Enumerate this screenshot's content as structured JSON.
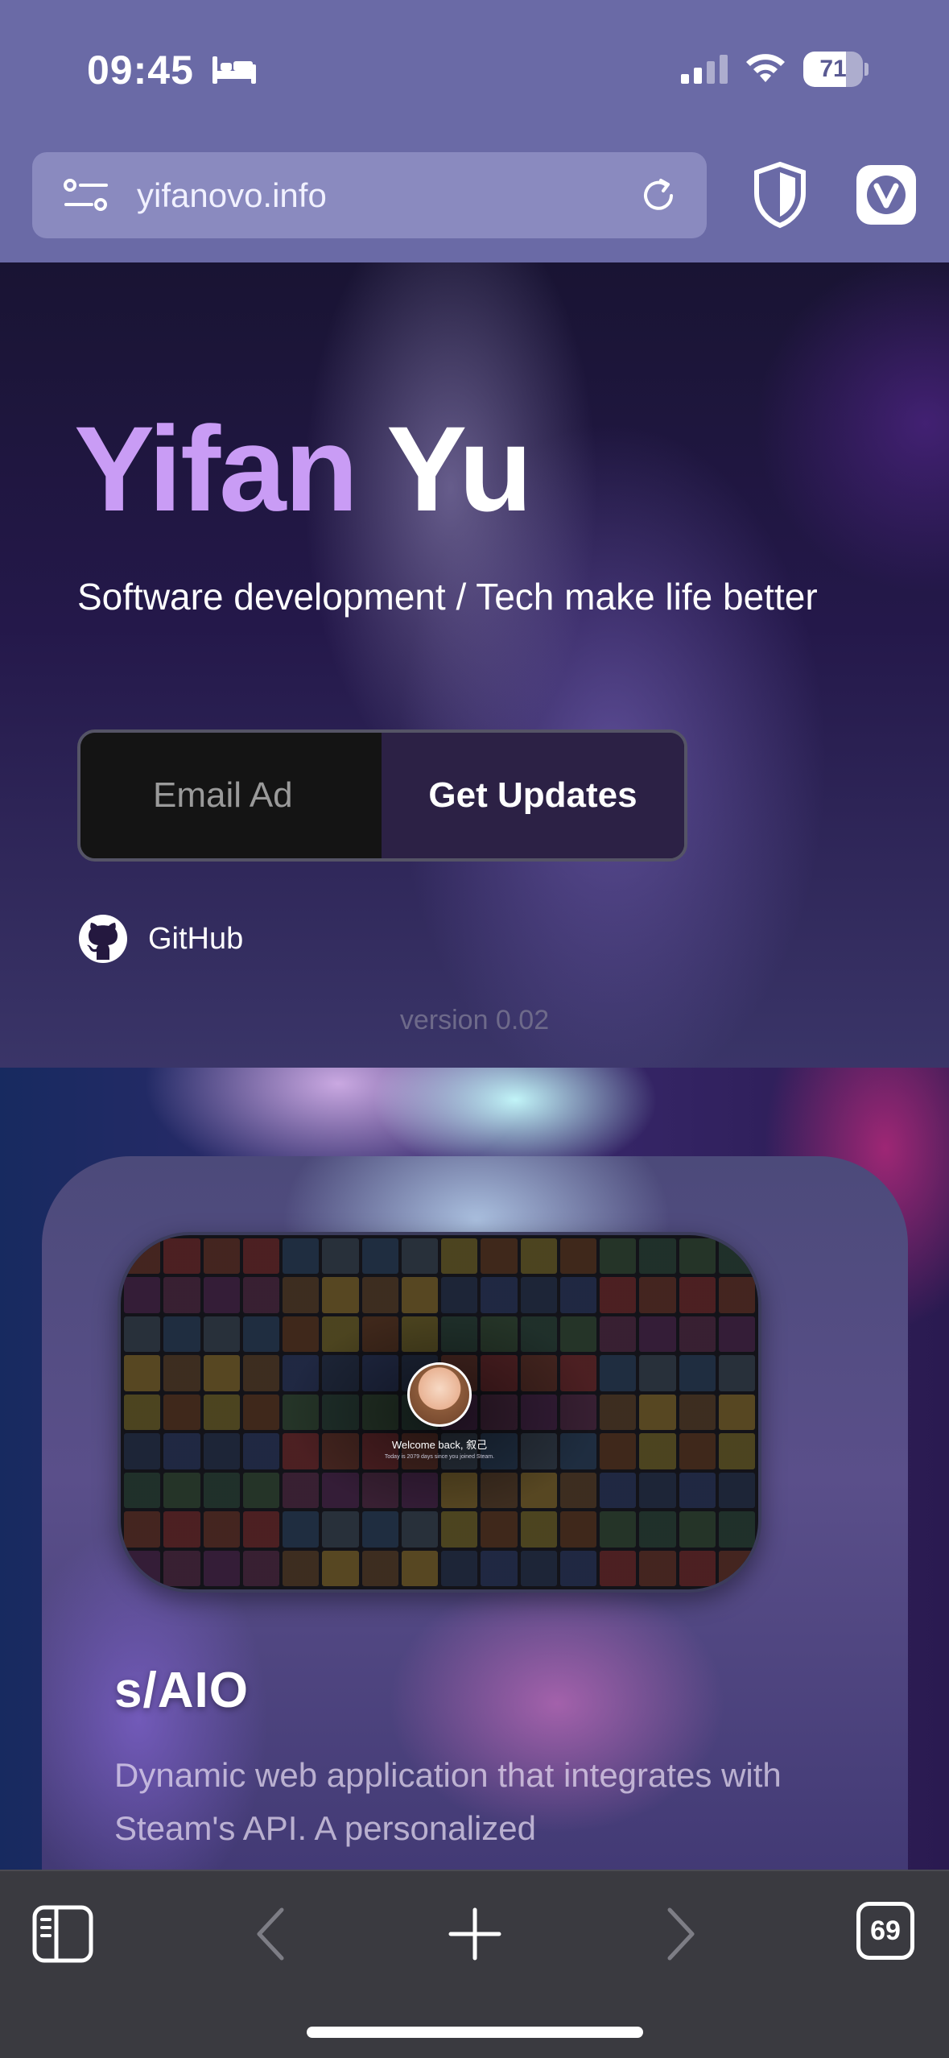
{
  "status_bar": {
    "time": "09:45",
    "battery_level": "71",
    "battery_fraction": 0.71,
    "icons": [
      "sleep-bed-icon",
      "cellular-signal-icon",
      "wifi-icon",
      "battery-icon"
    ]
  },
  "browser": {
    "url": "yifanovo.info",
    "icons": [
      "site-settings-icon",
      "reload-icon",
      "shield-icon",
      "vivaldi-icon"
    ],
    "toolbar": {
      "icons": [
        "panel-icon",
        "back-icon",
        "new-tab-icon",
        "forward-icon",
        "tabs-icon"
      ],
      "tab_count": "69"
    }
  },
  "hero": {
    "first_name": "Yifan",
    "last_name": "Yu",
    "tagline": "Software development / Tech make life better",
    "email_placeholder": "Email Ad",
    "submit_label": "Get Updates",
    "github_label": "GitHub",
    "version": "version 0.02"
  },
  "project": {
    "title": "s/AIO",
    "description": "Dynamic web application that integrates with Steam's API. A personalized",
    "screenshot": {
      "welcome": "Welcome back, 叙己",
      "joined": "Today is 2079 days since you joined Steam."
    }
  },
  "colors": {
    "chrome": "#6a6aa6",
    "url_field": "#8a8abf",
    "name_accent": "#c99cf5",
    "toolbar": "#3a3a40"
  }
}
